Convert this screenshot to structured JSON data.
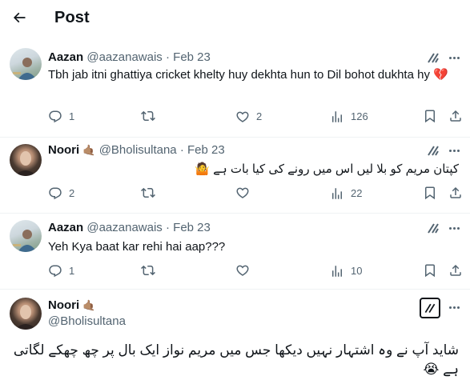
{
  "header": {
    "title": "Post"
  },
  "replies": [
    {
      "display_name": "Aazan",
      "handle": "@aazanawais",
      "date": "Feb 23",
      "text": "Tbh jab itni ghattiya cricket khelty huy dekhta hun to Dil bohot dukhta hy 💔",
      "rtl": false,
      "replies": "1",
      "reposts": "",
      "likes": "2",
      "views": "126"
    },
    {
      "display_name": "Noori",
      "name_badge": "🤙🏽",
      "handle": "@Bholisultana",
      "date": "Feb 23",
      "text": "کپتان مریم کو بلا لیں اس میں رونے کی کیا بات ہے 🤷",
      "rtl": true,
      "replies": "2",
      "reposts": "",
      "likes": "",
      "views": "22"
    },
    {
      "display_name": "Aazan",
      "handle": "@aazanawais",
      "date": "Feb 23",
      "text": "Yeh Kya baat kar rehi hai aap???",
      "rtl": false,
      "replies": "1",
      "reposts": "",
      "likes": "",
      "views": "10"
    }
  ],
  "main_post": {
    "display_name": "Noori",
    "name_badge": "🤙🏽",
    "handle": "@Bholisultana",
    "text": "شاید آپ نے وہ اشتہار نہیں دیکھا جس میں مریم نواز ایک بال پر چھ چھکے لگاتی ہے 😭"
  },
  "icons": {
    "back": "arrow-left-icon",
    "grok": "grok-icon",
    "more": "more-horizontal-icon",
    "reply": "reply-icon",
    "repost": "repost-icon",
    "like": "like-icon",
    "views": "views-icon",
    "bookmark": "bookmark-icon",
    "share": "share-icon"
  },
  "colors": {
    "text": "#0f1419",
    "secondary": "#536471",
    "divider": "#eff3f4"
  }
}
